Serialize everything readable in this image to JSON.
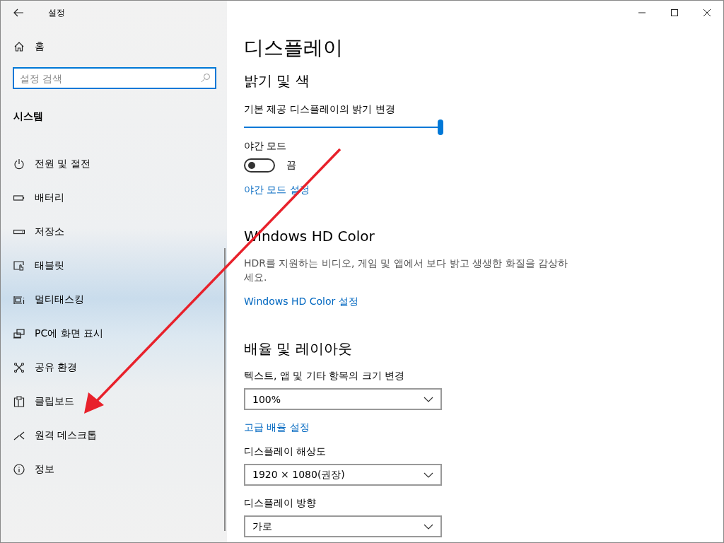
{
  "window": {
    "title": "설정"
  },
  "sidebar": {
    "home": "홈",
    "search": {
      "placeholder": "설정 검색"
    },
    "section": "시스템",
    "items": [
      {
        "label": "전원 및 절전",
        "selected": false
      },
      {
        "label": "배터리",
        "selected": false
      },
      {
        "label": "저장소",
        "selected": false
      },
      {
        "label": "태블릿",
        "selected": false
      },
      {
        "label": "멀티태스킹",
        "selected": false
      },
      {
        "label": "PC에 화면 표시",
        "selected": false
      },
      {
        "label": "공유 환경",
        "selected": false
      },
      {
        "label": "클립보드",
        "selected": false
      },
      {
        "label": "원격 데스크톱",
        "selected": false
      },
      {
        "label": "정보",
        "selected": false
      }
    ]
  },
  "page": {
    "title": "디스플레이",
    "brightness": {
      "heading": "밝기 및 색",
      "label": "기본 제공 디스플레이의 밝기 변경",
      "level": 1,
      "night_mode": {
        "label": "야간 모드",
        "on": false,
        "state_text": "끔"
      },
      "link": "야간 모드 설정"
    },
    "hd_color": {
      "heading": "Windows HD Color",
      "description": "HDR를 지원하는 비디오, 게임 및 앱에서 보다 밝고 생생한 화질을 감상하세요.",
      "link": "Windows HD Color 설정"
    },
    "scale": {
      "heading": "배율 및 레이아웃",
      "fields": [
        {
          "kind": "dropdown",
          "label": "텍스트, 앱 및 기타 항목의 크기 변경",
          "value": "100%"
        },
        {
          "kind": "link",
          "label": "고급 배율 설정"
        },
        {
          "kind": "dropdown",
          "label": "디스플레이 해상도",
          "value": "1920 × 1080(권장)"
        },
        {
          "kind": "dropdown",
          "label": "디스플레이 방향",
          "value": "가로"
        }
      ]
    }
  }
}
